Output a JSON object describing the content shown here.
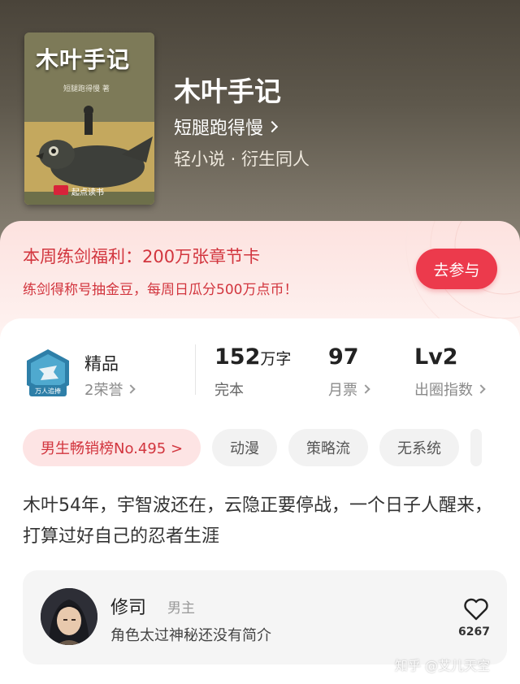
{
  "book": {
    "cover_title": "木叶手记",
    "cover_author": "短腿跑得慢 著",
    "cover_publisher": "起点读书",
    "title": "木叶手记",
    "author": "短腿跑得慢",
    "genre": "轻小说 · 衍生同人"
  },
  "promo": {
    "title": "本周练剑福利：200万张章节卡",
    "subtitle": "练剑得称号抽金豆，每周日瓜分500万点币！",
    "button_label": "去参与"
  },
  "stats": {
    "badge_text": "万人追捧",
    "quality_label": "精品",
    "honors": "2荣誉",
    "words_value": "152",
    "words_unit": "万字",
    "status": "完本",
    "monthly_votes": "97",
    "monthly_votes_label": "月票",
    "level": "Lv2",
    "level_label": "出圈指数"
  },
  "tags": [
    "男生畅销榜No.495 >",
    "动漫",
    "策略流",
    "无系统"
  ],
  "description": "木叶54年，宇智波还在，云隐正要停战，一个日子人醒来，打算过好自己的忍者生涯",
  "character": {
    "name": "修司",
    "role": "男主",
    "intro": "角色太过神秘还没有简介",
    "likes": "6267"
  },
  "watermark": "知乎 @艾儿天空",
  "colors": {
    "accent": "#ec3a4c",
    "promo_text": "#d2353e",
    "header_bg": "#5e584c"
  }
}
